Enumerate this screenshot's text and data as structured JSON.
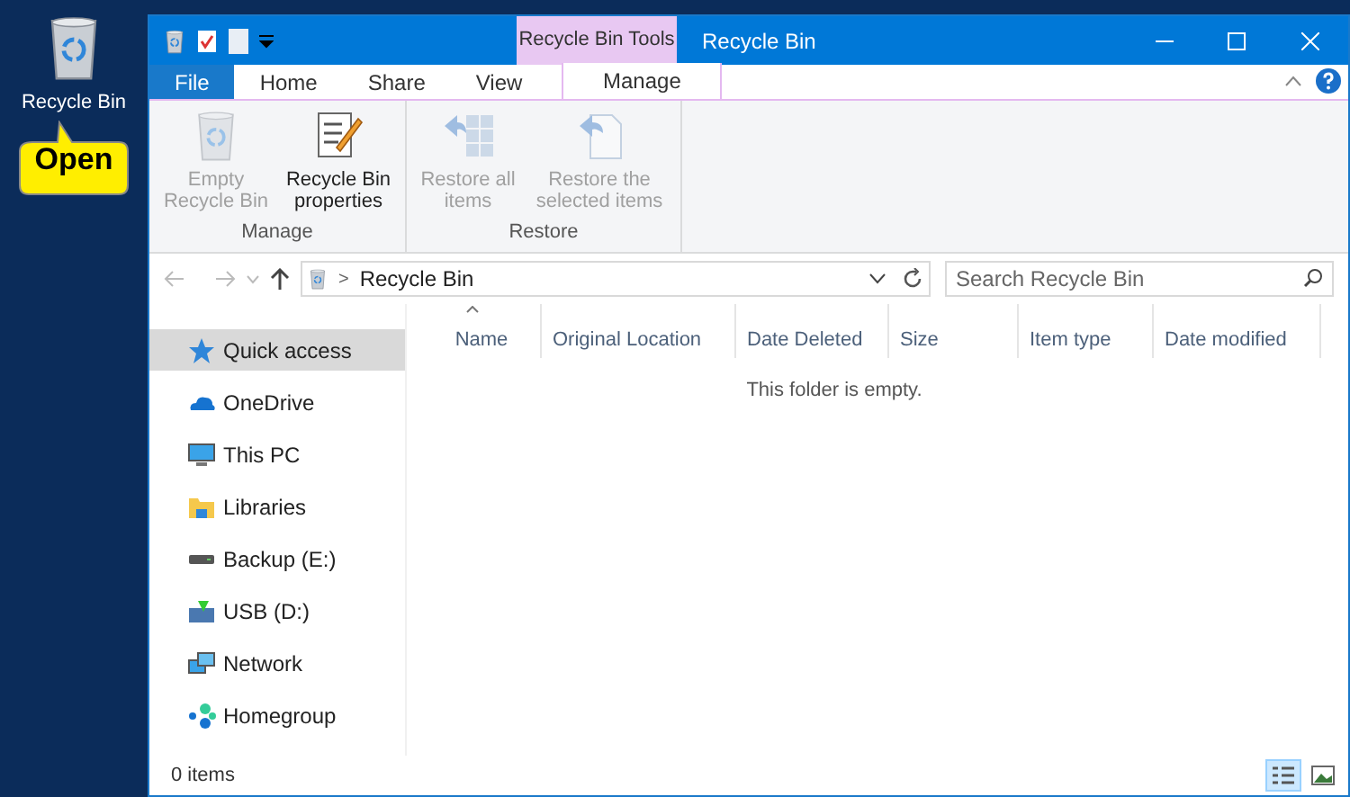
{
  "desktop": {
    "icon_label": "Recycle Bin",
    "callout": "Open"
  },
  "window": {
    "title": "Recycle Bin",
    "context_tab_group": "Recycle Bin Tools"
  },
  "tabs": [
    {
      "label": "File",
      "kind": "file",
      "selected": false
    },
    {
      "label": "Home",
      "kind": "tab",
      "selected": false
    },
    {
      "label": "Share",
      "kind": "tab",
      "selected": false
    },
    {
      "label": "View",
      "kind": "tab",
      "selected": false
    },
    {
      "label": "Manage",
      "kind": "context",
      "selected": true
    }
  ],
  "ribbon": {
    "groups": [
      {
        "label": "Manage",
        "buttons": [
          {
            "label": "Empty Recycle Bin",
            "kind": "empty",
            "disabled": true
          },
          {
            "label": "Recycle Bin properties",
            "kind": "properties",
            "disabled": false
          }
        ]
      },
      {
        "label": "Restore",
        "buttons": [
          {
            "label": "Restore all items",
            "kind": "restore_all",
            "disabled": true
          },
          {
            "label": "Restore the selected items",
            "kind": "restore_selected",
            "disabled": true
          }
        ]
      }
    ]
  },
  "address": {
    "separator": ">",
    "path": "Recycle Bin"
  },
  "search": {
    "placeholder": "Search Recycle Bin"
  },
  "sidebar": {
    "items": [
      {
        "label": "Quick access",
        "kind": "star",
        "selected": true
      },
      {
        "label": "OneDrive",
        "kind": "cloud",
        "selected": false
      },
      {
        "label": "This PC",
        "kind": "pc",
        "selected": false
      },
      {
        "label": "Libraries",
        "kind": "library",
        "selected": false
      },
      {
        "label": "Backup (E:)",
        "kind": "drive",
        "selected": false
      },
      {
        "label": "USB (D:)",
        "kind": "usb",
        "selected": false
      },
      {
        "label": "Network",
        "kind": "network",
        "selected": false
      },
      {
        "label": "Homegroup",
        "kind": "homegroup",
        "selected": false
      }
    ]
  },
  "table": {
    "columns": [
      {
        "label": "Name",
        "sorted": true
      },
      {
        "label": "Original Location",
        "sorted": false
      },
      {
        "label": "Date Deleted",
        "sorted": false
      },
      {
        "label": "Size",
        "sorted": false
      },
      {
        "label": "Item type",
        "sorted": false
      },
      {
        "label": "Date modified",
        "sorted": false
      }
    ],
    "empty_message": "This folder is empty."
  },
  "status_bar": {
    "count": "0 items"
  },
  "view_buttons": [
    {
      "kind": "details",
      "selected": true
    },
    {
      "kind": "thumbnails",
      "selected": false
    }
  ]
}
